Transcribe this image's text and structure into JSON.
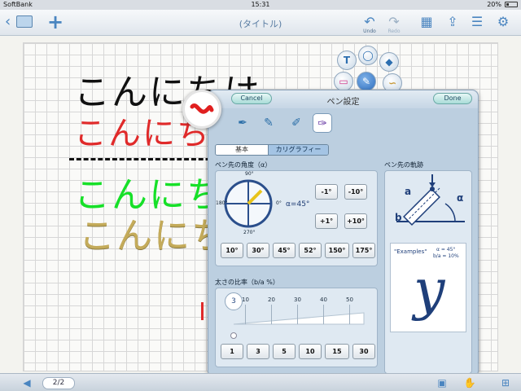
{
  "status_bar": {
    "carrier": "SoftBank",
    "time": "15:31",
    "battery": "20%"
  },
  "toolbar": {
    "title": "(タイトル)",
    "undo_label": "Undo",
    "redo_label": "Redo"
  },
  "canvas": {
    "line1": "こんにちは",
    "line2": "こんにち",
    "line3": "こんにちは",
    "line4": "こんにち"
  },
  "palette": {
    "tools": [
      "text-tool-icon",
      "lasso-icon",
      "eraser-icon",
      "shape-icon",
      "pen-icon",
      "curve-icon"
    ],
    "text_glyph": "T"
  },
  "pen_settings": {
    "title": "ペン設定",
    "cancel_label": "Cancel",
    "done_label": "Done",
    "pen_types": [
      "pen-fine-icon",
      "pen-dotted-icon",
      "pen-brush-icon",
      "pen-calligraphy-icon"
    ],
    "tabs": [
      {
        "label": "基本"
      },
      {
        "label": "カリグラフィー"
      }
    ],
    "angle_section": {
      "label": "ペン先の角度（α）",
      "dial_labels": {
        "top": "90°",
        "left": "180°",
        "right": "0°",
        "bottom": "270°"
      },
      "current": "α=45°",
      "adjust_buttons": [
        "-1°",
        "-10°",
        "+1°",
        "+10°"
      ],
      "presets": [
        "10°",
        "30°",
        "45°",
        "52°",
        "150°",
        "175°"
      ]
    },
    "trajectory_section": {
      "label": "ペン先の軌跡",
      "diagram_a": "a",
      "diagram_b": "b",
      "diagram_alpha": "α",
      "examples_label": "\"Examples\"",
      "examples_alpha": "α = 45°",
      "examples_ratio": "b/a = 10%",
      "examples_glyph": "y"
    },
    "ratio_section": {
      "label": "太さの比率（b/a %）",
      "current": "3",
      "current_value": 3,
      "ticks": [
        "10",
        "20",
        "30",
        "40",
        "50"
      ],
      "presets": [
        "1",
        "3",
        "5",
        "10",
        "15",
        "30"
      ]
    }
  },
  "bottom_bar": {
    "page_indicator": "2/2"
  },
  "colors": {
    "accent": "#4a85c0",
    "panel": "#bccfe0",
    "red_ink": "#e02a2a",
    "green_ink": "#16e028",
    "gold_ink": "#c4ab5a"
  }
}
